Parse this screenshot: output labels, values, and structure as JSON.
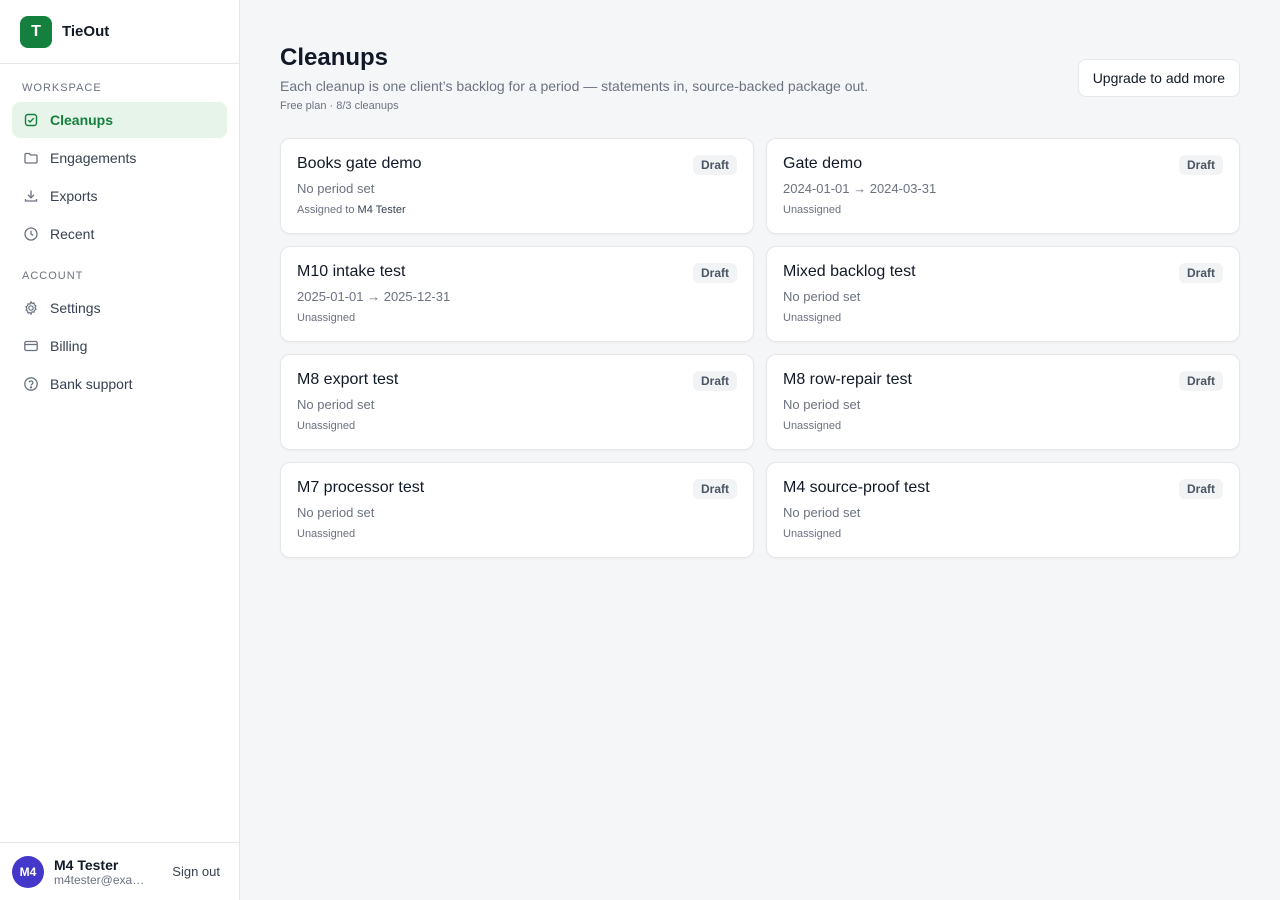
{
  "brand": {
    "logo_letter": "T",
    "name": "TieOut",
    "accent": "#15803d"
  },
  "sidebar": {
    "workspace_label": "WORKSPACE",
    "workspace_items": [
      {
        "label": "Cleanups",
        "icon": "checklist-icon",
        "active": true
      },
      {
        "label": "Engagements",
        "icon": "folder-icon"
      },
      {
        "label": "Exports",
        "icon": "download-icon"
      },
      {
        "label": "Recent",
        "icon": "clock-icon"
      }
    ],
    "account_label": "ACCOUNT",
    "account_items": [
      {
        "label": "Settings",
        "icon": "gear-icon"
      },
      {
        "label": "Billing",
        "icon": "credit-card-icon"
      },
      {
        "label": "Bank support",
        "icon": "help-circle-icon"
      }
    ]
  },
  "user": {
    "initials": "M4",
    "name": "M4 Tester",
    "email": "m4tester@exa…",
    "sign_out_label": "Sign out"
  },
  "main": {
    "title": "Cleanups",
    "subtitle": "Each cleanup is one client’s backlog for a period — statements in, source-backed package out.",
    "plan_note": "Free plan · 8/3 cleanups",
    "upgrade_label": "Upgrade to add more"
  },
  "cards": [
    {
      "title": "Books gate demo",
      "status": "Draft",
      "period": "No period set",
      "assign_prefix": "Assigned to ",
      "assignee": "M4 Tester"
    },
    {
      "title": "Gate demo",
      "status": "Draft",
      "period": "2024-01-01 → 2024-03-31",
      "assign_prefix": "Unassigned",
      "assignee": ""
    },
    {
      "title": "M10 intake test",
      "status": "Draft",
      "period": "2025-01-01 → 2025-12-31",
      "assign_prefix": "Unassigned",
      "assignee": ""
    },
    {
      "title": "Mixed backlog test",
      "status": "Draft",
      "period": "No period set",
      "assign_prefix": "Unassigned",
      "assignee": ""
    },
    {
      "title": "M8 export test",
      "status": "Draft",
      "period": "No period set",
      "assign_prefix": "Unassigned",
      "assignee": ""
    },
    {
      "title": "M8 row-repair test",
      "status": "Draft",
      "period": "No period set",
      "assign_prefix": "Unassigned",
      "assignee": ""
    },
    {
      "title": "M7 processor test",
      "status": "Draft",
      "period": "No period set",
      "assign_prefix": "Unassigned",
      "assignee": ""
    },
    {
      "title": "M4 source-proof test",
      "status": "Draft",
      "period": "No period set",
      "assign_prefix": "Unassigned",
      "assignee": ""
    }
  ]
}
